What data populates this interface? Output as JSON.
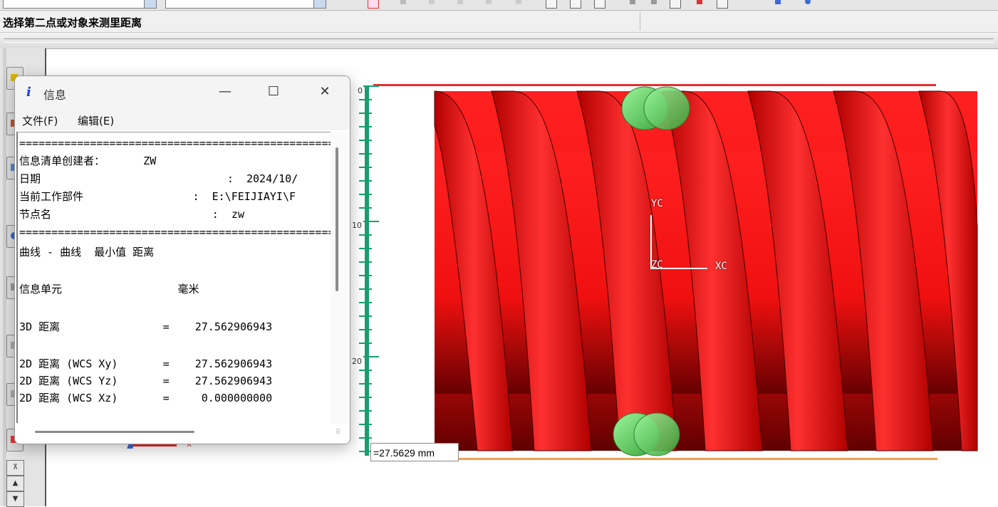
{
  "prompt": "选择第二点或对象来测里距离",
  "info_window": {
    "icon_letter": "i",
    "title": "信息",
    "controls": {
      "minimize": "—",
      "maximize": "☐",
      "close": "✕"
    },
    "menu": [
      "文件(F)",
      "编辑(E)"
    ],
    "lines": [
      "=====================================================",
      "信息清单创建者：      ZW",
      "日期                             :  2024/10/",
      "当前工作部件                 :  E:\\FEIJIAYI\\F",
      "节点名                         :  zw",
      "=====================================================",
      "曲线 - 曲线  最小值 距离",
      "",
      "信息单元                  毫米",
      "",
      "3D 距离                =    27.562906943",
      "",
      "2D 距离 (WCS Xy)       =    27.562906943",
      "2D 距离 (WCS Yz)       =    27.562906943",
      "2D 距离 (WCS Xz)       =     0.000000000"
    ]
  },
  "ruler": {
    "labels": [
      "0",
      "10",
      "20"
    ]
  },
  "measurement": "=27.5629 mm",
  "wcs_labels": {
    "y": "YC",
    "z": "ZC",
    "x": "XC"
  },
  "triad_x": "x",
  "colors": {
    "thread": "#ff1a1a",
    "ball": "#6fdc6f",
    "ruler": "#17a06d",
    "top_line": "#e23030",
    "bottom_line": "#f0a050"
  }
}
